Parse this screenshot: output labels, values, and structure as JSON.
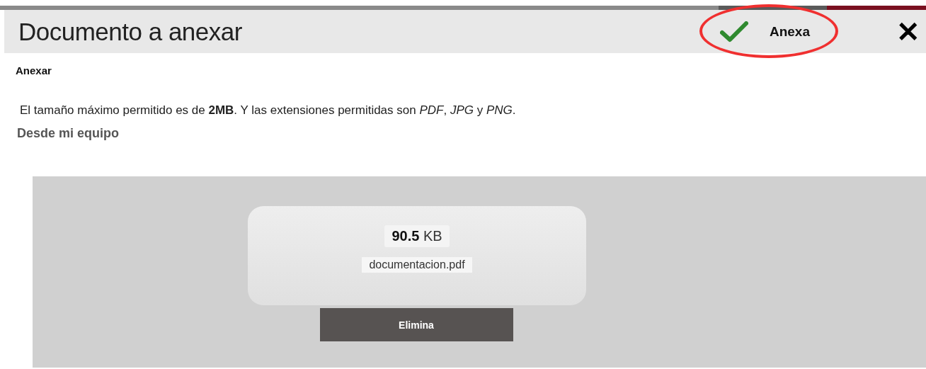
{
  "dialog": {
    "title": "Documento a anexar",
    "confirm_button": "Anexa",
    "close_button": "✕"
  },
  "section_title": "Anexar",
  "info": "El tamaño máximo permitido es de **2MB**. Y las extensiones permitidas son *PDF*, *JPG* y *PNG*.",
  "source_label": "Desde mi equipo",
  "file": {
    "size": "**90.5** KB",
    "name": "documentacion.pdf",
    "delete_button": "Elimina"
  }
}
